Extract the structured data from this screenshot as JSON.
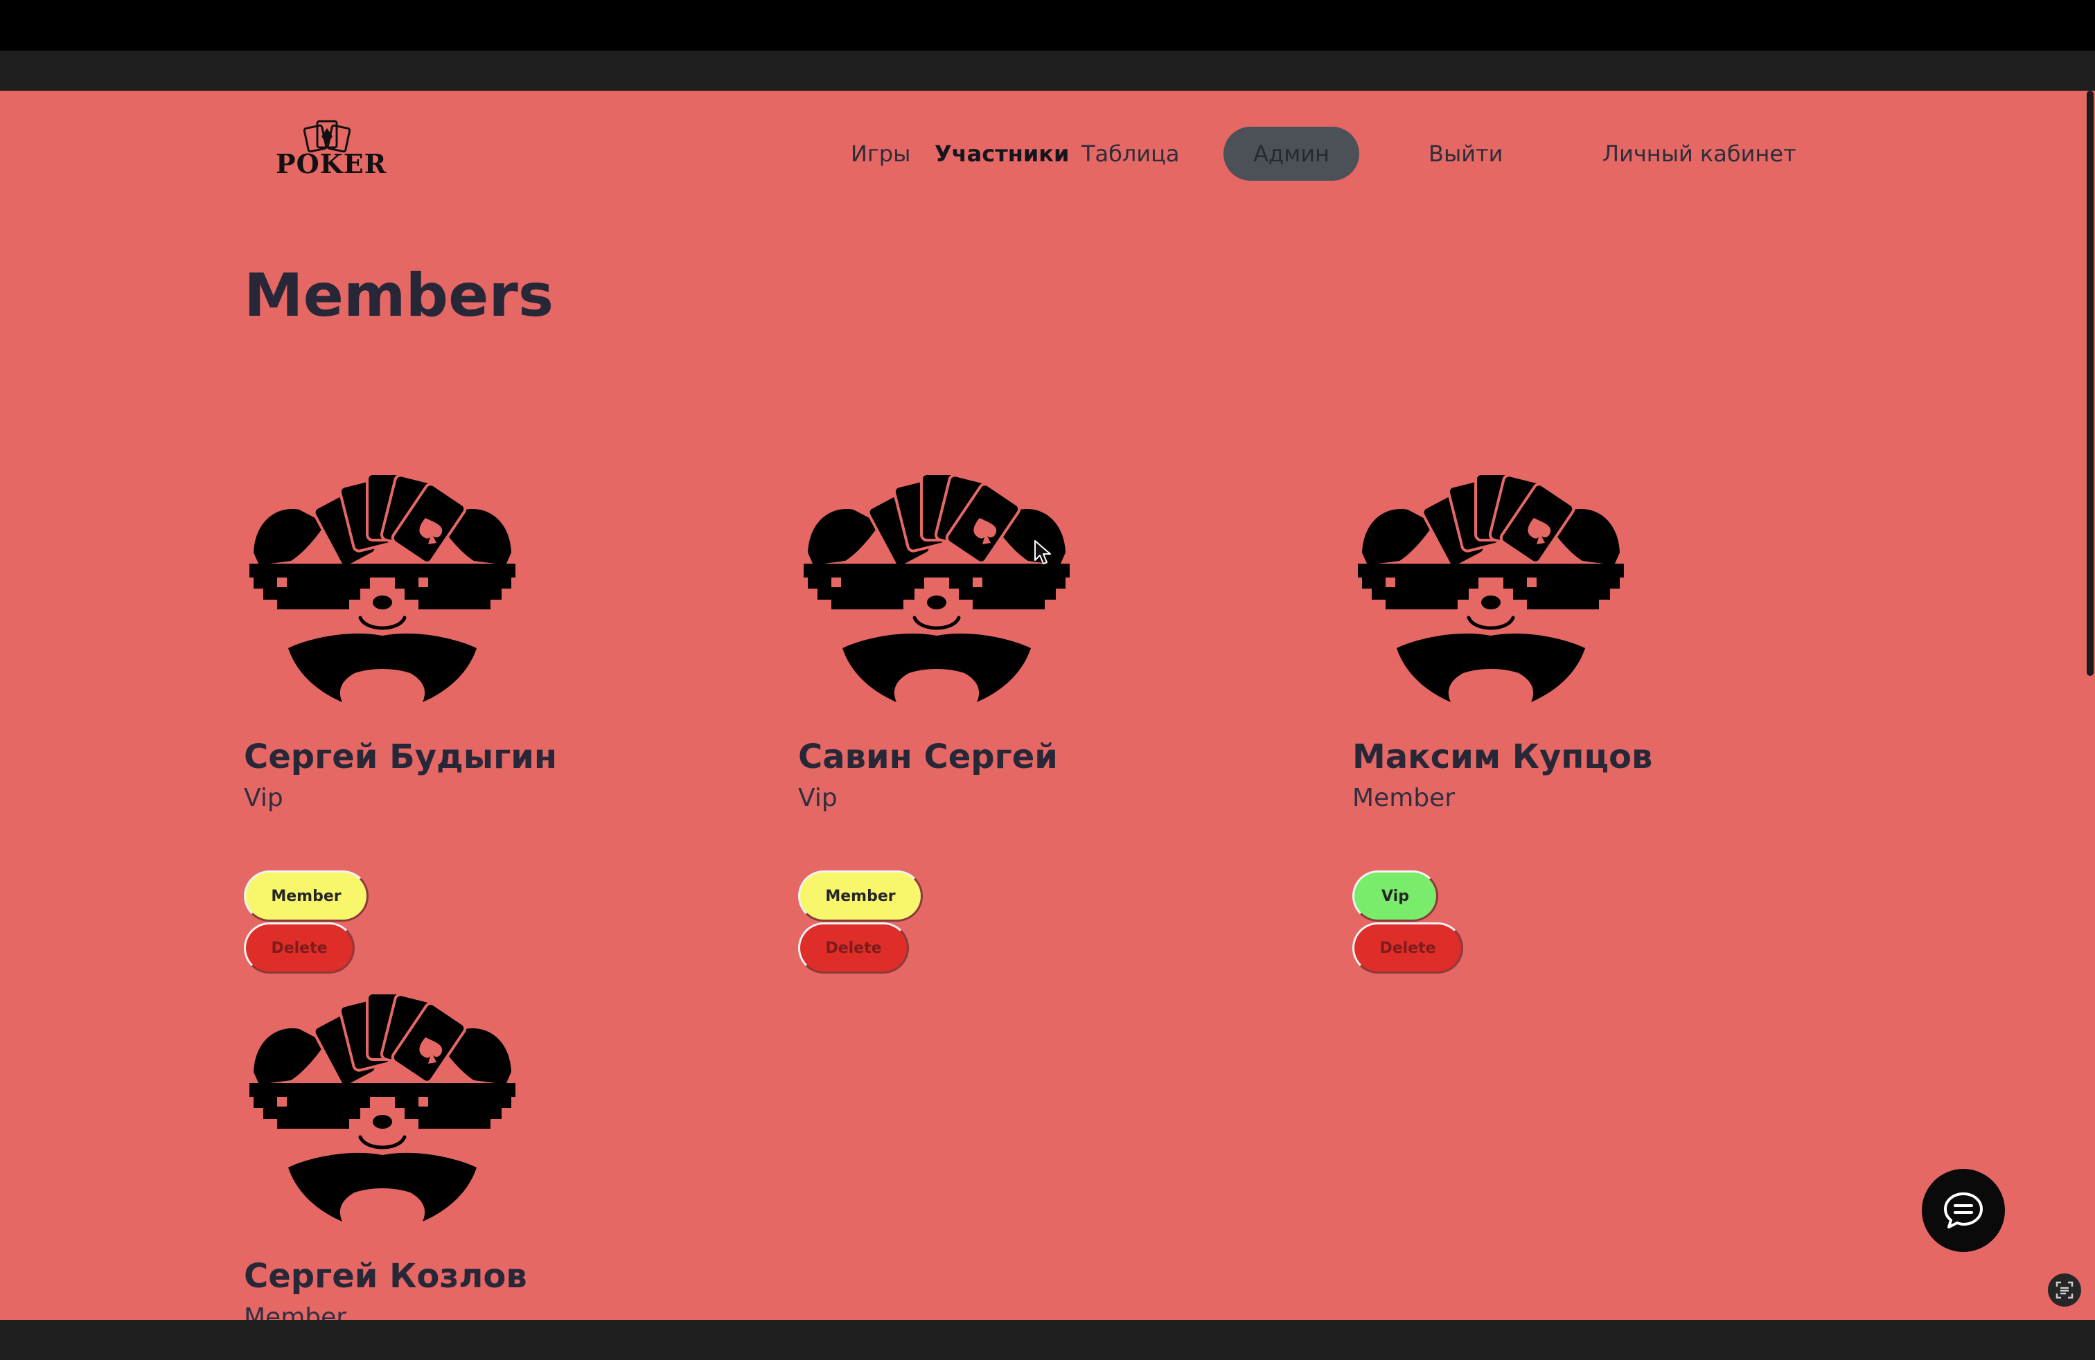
{
  "brand": {
    "logo_text": "POKER"
  },
  "nav": {
    "games": "Игры",
    "members": "Участники",
    "table": "Таблица",
    "admin": "Админ",
    "logout": "Выйти",
    "cabinet": "Личный кабинет"
  },
  "page": {
    "title": "Members"
  },
  "members": [
    {
      "name": "Сергей Будыгин",
      "status": "Vip",
      "role_button": "Member",
      "delete_button": "Delete"
    },
    {
      "name": "Савин Сергей",
      "status": "Vip",
      "role_button": "Member",
      "delete_button": "Delete"
    },
    {
      "name": "Максим Купцов",
      "status": "Member",
      "role_button": "Vip",
      "delete_button": "Delete"
    },
    {
      "name": "Сергей Козлов",
      "status": "Member"
    }
  ],
  "colors": {
    "page_bg": "#e56865",
    "member_button": "#f8f66a",
    "vip_button": "#79ec6b",
    "delete_button": "#df2e2a",
    "admin_pill": "#4b5157"
  },
  "icons": [
    "poker-logo-icon",
    "panda-avatar-icon",
    "chat-icon",
    "screenshot-icon",
    "mouse-cursor-icon"
  ]
}
